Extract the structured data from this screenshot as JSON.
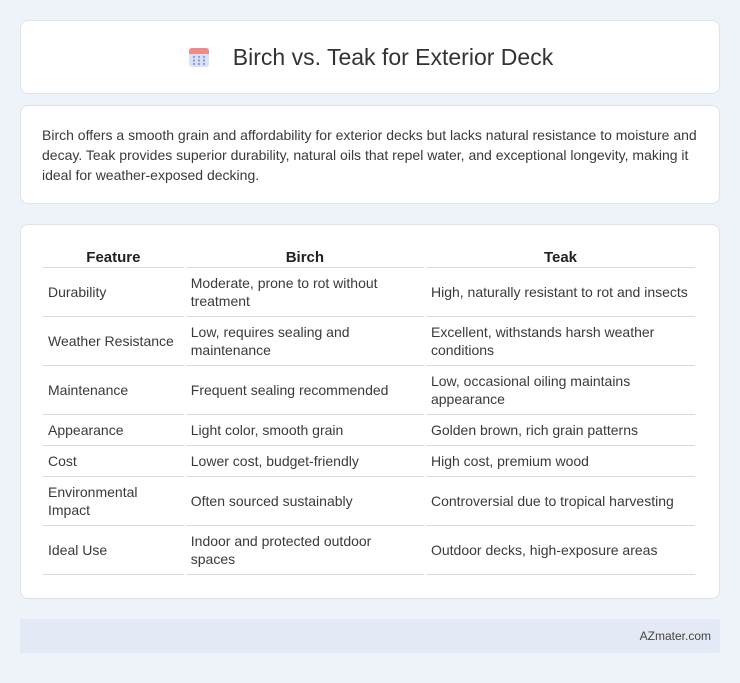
{
  "header": {
    "title": "Birch vs. Teak for Exterior Deck",
    "icon": "calendar-icon"
  },
  "summary": {
    "text": "Birch offers a smooth grain and affordability for exterior decks but lacks natural resistance to moisture and decay. Teak provides superior durability, natural oils that repel water, and exceptional longevity, making it ideal for weather-exposed decking."
  },
  "table": {
    "headers": [
      "Feature",
      "Birch",
      "Teak"
    ],
    "rows": [
      [
        "Durability",
        "Moderate, prone to rot without treatment",
        "High, naturally resistant to rot and insects"
      ],
      [
        "Weather Resistance",
        "Low, requires sealing and maintenance",
        "Excellent, withstands harsh weather conditions"
      ],
      [
        "Maintenance",
        "Frequent sealing recommended",
        "Low, occasional oiling maintains appearance"
      ],
      [
        "Appearance",
        "Light color, smooth grain",
        "Golden brown, rich grain patterns"
      ],
      [
        "Cost",
        "Lower cost, budget-friendly",
        "High cost, premium wood"
      ],
      [
        "Environmental Impact",
        "Often sourced sustainably",
        "Controversial due to tropical harvesting"
      ],
      [
        "Ideal Use",
        "Indoor and protected outdoor spaces",
        "Outdoor decks, high-exposure areas"
      ]
    ]
  },
  "footer": {
    "brand": "AZmater.com"
  }
}
